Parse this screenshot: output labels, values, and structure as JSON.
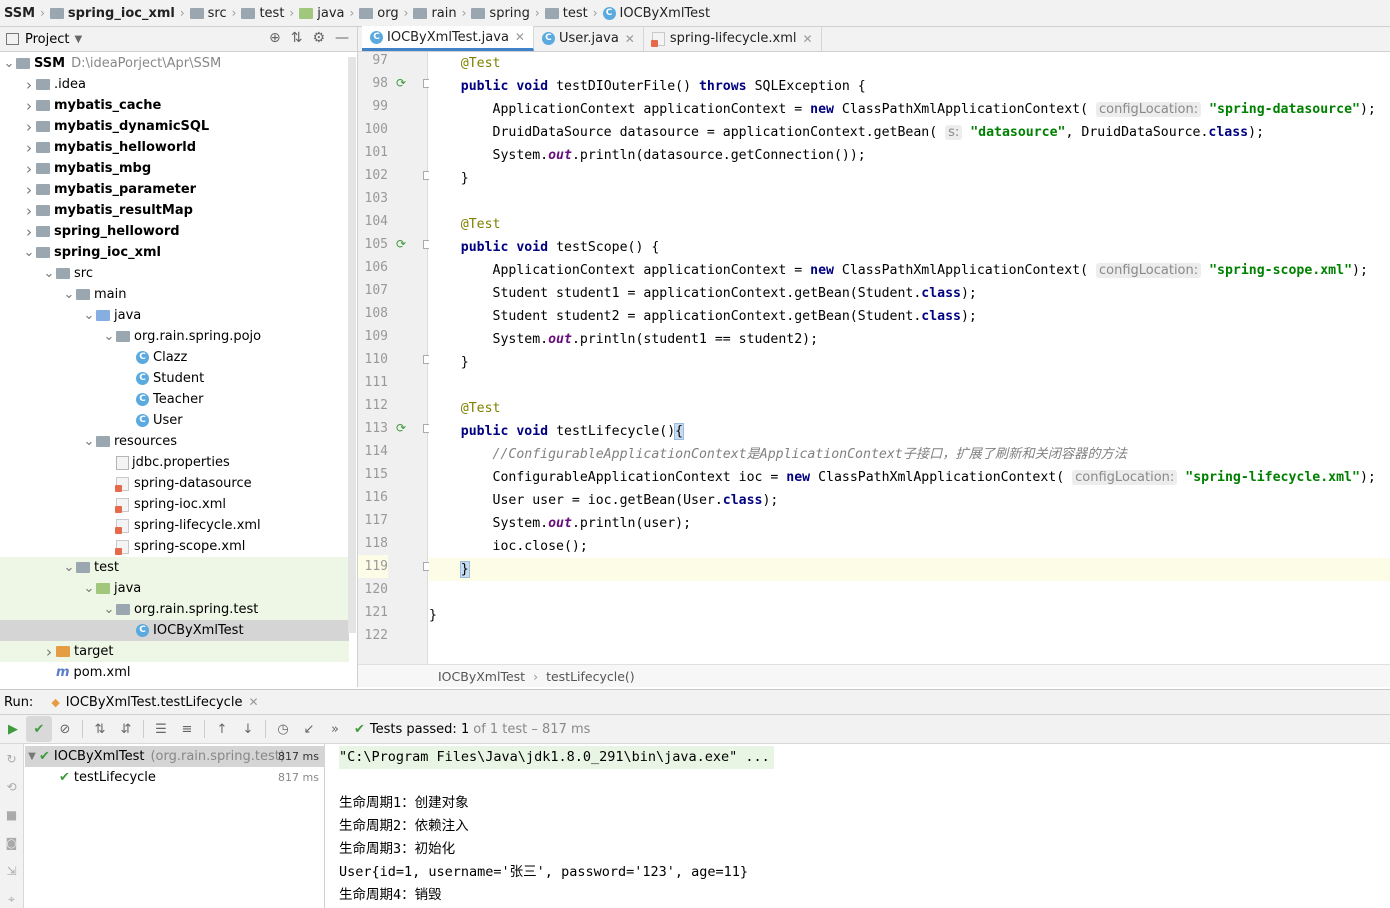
{
  "breadcrumb": [
    {
      "label": "SSM",
      "icon": "none",
      "bold": true
    },
    {
      "label": "spring_ioc_xml",
      "icon": "module-folder-icon",
      "bold": true
    },
    {
      "label": "src",
      "icon": "folder-icon",
      "bold": false
    },
    {
      "label": "test",
      "icon": "folder-icon",
      "bold": false
    },
    {
      "label": "java",
      "icon": "test-source-folder-icon",
      "bold": false
    },
    {
      "label": "org",
      "icon": "package-icon",
      "bold": false
    },
    {
      "label": "rain",
      "icon": "package-icon",
      "bold": false
    },
    {
      "label": "spring",
      "icon": "package-icon",
      "bold": false
    },
    {
      "label": "test",
      "icon": "package-icon",
      "bold": false
    },
    {
      "label": "IOCByXmlTest",
      "icon": "class-icon",
      "bold": false
    }
  ],
  "project_panel": {
    "title": "Project",
    "root": {
      "label": "SSM",
      "path": "D:\\ideaPorject\\Apr\\SSM"
    },
    "items": [
      {
        "label": ".idea",
        "level": 1,
        "arrow": "right",
        "icon": "folder",
        "bold": false
      },
      {
        "label": "mybatis_cache",
        "level": 1,
        "arrow": "right",
        "icon": "module",
        "bold": true
      },
      {
        "label": "mybatis_dynamicSQL",
        "level": 1,
        "arrow": "right",
        "icon": "module",
        "bold": true
      },
      {
        "label": "mybatis_helloworld",
        "level": 1,
        "arrow": "right",
        "icon": "module",
        "bold": true
      },
      {
        "label": "mybatis_mbg",
        "level": 1,
        "arrow": "right",
        "icon": "module",
        "bold": true
      },
      {
        "label": "mybatis_parameter",
        "level": 1,
        "arrow": "right",
        "icon": "module",
        "bold": true
      },
      {
        "label": "mybatis_resultMap",
        "level": 1,
        "arrow": "right",
        "icon": "module",
        "bold": true
      },
      {
        "label": "spring_helloword",
        "level": 1,
        "arrow": "right",
        "icon": "module",
        "bold": true
      },
      {
        "label": "spring_ioc_xml",
        "level": 1,
        "arrow": "down",
        "icon": "module",
        "bold": true
      },
      {
        "label": "src",
        "level": 2,
        "arrow": "down",
        "icon": "folder",
        "bold": false
      },
      {
        "label": "main",
        "level": 3,
        "arrow": "down",
        "icon": "folder",
        "bold": false
      },
      {
        "label": "java",
        "level": 4,
        "arrow": "down",
        "icon": "source",
        "bold": false
      },
      {
        "label": "org.rain.spring.pojo",
        "level": 5,
        "arrow": "down",
        "icon": "package",
        "bold": false
      },
      {
        "label": "Clazz",
        "level": 6,
        "arrow": "none",
        "icon": "class",
        "bold": false
      },
      {
        "label": "Student",
        "level": 6,
        "arrow": "none",
        "icon": "class",
        "bold": false
      },
      {
        "label": "Teacher",
        "level": 6,
        "arrow": "none",
        "icon": "class",
        "bold": false
      },
      {
        "label": "User",
        "level": 6,
        "arrow": "none",
        "icon": "class",
        "bold": false
      },
      {
        "label": "resources",
        "level": 4,
        "arrow": "down",
        "icon": "resources",
        "bold": false
      },
      {
        "label": "jdbc.properties",
        "level": 5,
        "arrow": "none",
        "icon": "properties",
        "bold": false
      },
      {
        "label": "spring-datasource",
        "level": 5,
        "arrow": "none",
        "icon": "xml",
        "bold": false
      },
      {
        "label": "spring-ioc.xml",
        "level": 5,
        "arrow": "none",
        "icon": "xml",
        "bold": false
      },
      {
        "label": "spring-lifecycle.xml",
        "level": 5,
        "arrow": "none",
        "icon": "xml",
        "bold": false
      },
      {
        "label": "spring-scope.xml",
        "level": 5,
        "arrow": "none",
        "icon": "xml",
        "bold": false
      },
      {
        "label": "test",
        "level": 3,
        "arrow": "down",
        "icon": "folder",
        "bold": false
      },
      {
        "label": "java",
        "level": 4,
        "arrow": "down",
        "icon": "test-source",
        "bold": false
      },
      {
        "label": "org.rain.spring.test",
        "level": 5,
        "arrow": "down",
        "icon": "package",
        "bold": false
      },
      {
        "label": "IOCByXmlTest",
        "level": 6,
        "arrow": "none",
        "icon": "test-class",
        "bold": false
      },
      {
        "label": "target",
        "level": 2,
        "arrow": "right",
        "icon": "excluded",
        "bold": false
      },
      {
        "label": "pom.xml",
        "level": 2,
        "arrow": "none",
        "icon": "maven",
        "bold": false
      }
    ]
  },
  "editor_tabs": [
    {
      "label": "IOCByXmlTest.java",
      "active": true
    },
    {
      "label": "User.java",
      "active": false
    },
    {
      "label": "spring-lifecycle.xml",
      "active": false
    }
  ],
  "code": {
    "line_numbers": [
      "97",
      "98",
      "99",
      "100",
      "101",
      "102",
      "103",
      "104",
      "105",
      "106",
      "107",
      "108",
      "109",
      "110",
      "111",
      "112",
      "113",
      "114",
      "115",
      "116",
      "117",
      "118",
      "119",
      "120",
      "121",
      "122"
    ],
    "run_markers": [
      "98",
      "105",
      "113"
    ],
    "current_line": "119",
    "lines": {
      "l97_ann": "@Test",
      "l98_sig": " testDIOuterFile() ",
      "l98_tail": " SQLException {",
      "l99_a": "ApplicationContext applicationContext = ",
      "l99_b": " ClassPathXmlApplicationContext(",
      "l99_hint": "configLocation:",
      "l99_str": "\"spring-datasource\"",
      "l99_end": ");",
      "l100_a": "DruidDataSource datasource = applicationContext.getBean(",
      "l100_hint": "s:",
      "l100_str": "\"datasource\"",
      "l100_b": ", DruidDataSource.",
      "l100_end": ");",
      "l101_a": "System.",
      "l101_out": "out",
      "l101_b": ".println(datasource.getConnection());",
      "l102": "}",
      "l104_ann": "@Test",
      "l105_sig": " testScope() {",
      "l106_a": "ApplicationContext applicationContext = ",
      "l106_b": " ClassPathXmlApplicationContext(",
      "l106_hint": "configLocation:",
      "l106_str": "\"spring-scope.xml\"",
      "l106_end": ");",
      "l107_a": "Student student1 = applicationContext.getBean(Student.",
      "l107_end": ");",
      "l108_a": "Student student2 = applicationContext.getBean(Student.",
      "l108_end": ");",
      "l109_a": "System.",
      "l109_out": "out",
      "l109_b": ".println(student1 == student2);",
      "l110": "}",
      "l112_ann": "@Test",
      "l113_sig": " testLifecycle()",
      "l113_brace": "{",
      "l114_cmt": "//ConfigurableApplicationContext是ApplicationContext子接口，扩展了刷新和关闭容器的方法",
      "l115_a": "ConfigurableApplicationContext ioc = ",
      "l115_b": " ClassPathXmlApplicationContext(",
      "l115_hint": "configLocation:",
      "l115_str": "\"spring-lifecycle.xml\"",
      "l115_end": ");",
      "l116_a": "User user = ioc.getBean(User.",
      "l116_end": ");",
      "l117_a": "System.",
      "l117_out": "out",
      "l117_b": ".println(user);",
      "l118": "ioc.close();",
      "l119": "}",
      "l121": "}",
      "kw_public": "public",
      "kw_void": "void",
      "kw_throws": "throws",
      "kw_new": "new",
      "kw_class": "class"
    }
  },
  "editor_breadcrumb": {
    "class_name": "IOCByXmlTest",
    "method_name": "testLifecycle()"
  },
  "run_panel": {
    "label": "Run:",
    "tab": "IOCByXmlTest.testLifecycle",
    "status": {
      "prefix": "Tests passed:",
      "passed": "1",
      "suffix": "of 1 test – 817 ms"
    },
    "tree": [
      {
        "label": "IOCByXmlTest",
        "pkg": "(org.rain.spring.test)",
        "time": "817 ms"
      },
      {
        "label": "testLifecycle",
        "pkg": "",
        "time": "817 ms"
      }
    ],
    "console": [
      "\"C:\\Program Files\\Java\\jdk1.8.0_291\\bin\\java.exe\" ...",
      "",
      "生命周期1：创建对象",
      "生命周期2：依赖注入",
      "生命周期3：初始化",
      "User{id=1, username='张三', password='123', age=11}",
      "生命周期4：销毁"
    ]
  },
  "colors": {
    "keyword": "#000080",
    "string": "#008000",
    "annotation": "#808000",
    "comment": "#808080",
    "accent": "#4083c9",
    "pass": "#3e9b3e"
  }
}
